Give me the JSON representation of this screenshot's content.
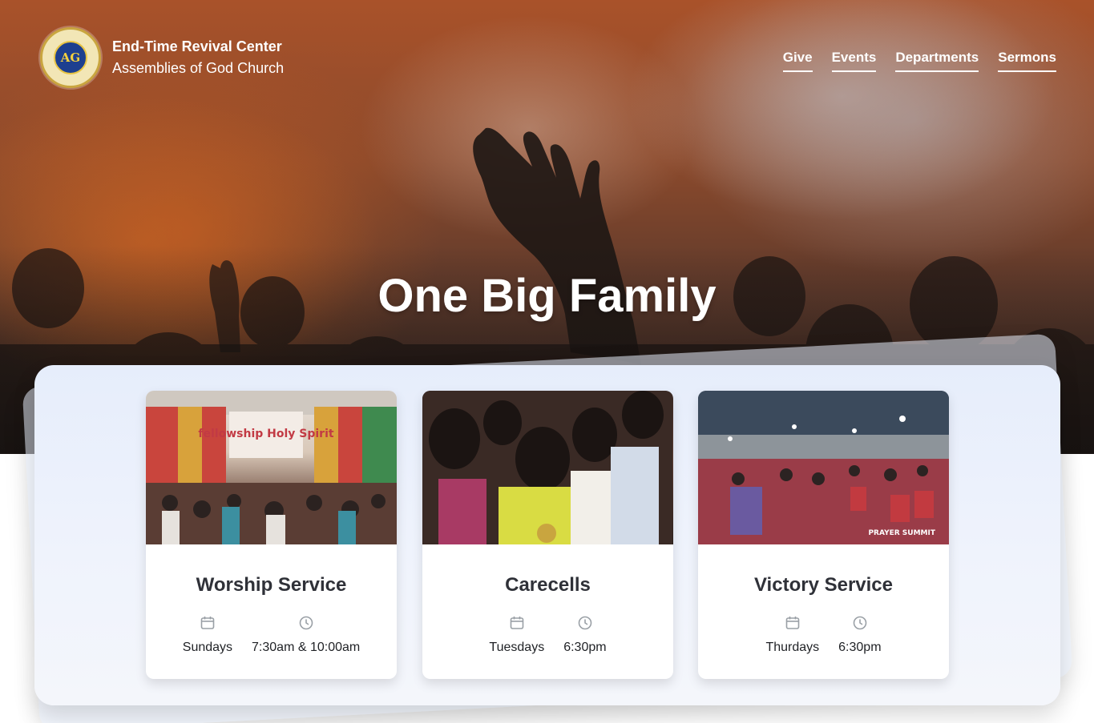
{
  "header": {
    "brand_title": "End-Time Revival Center",
    "brand_subtitle": "Assemblies of God Church",
    "logo_text": "AG",
    "nav": [
      {
        "label": "Give"
      },
      {
        "label": "Events"
      },
      {
        "label": "Departments"
      },
      {
        "label": "Sermons"
      }
    ]
  },
  "hero": {
    "title": "One Big Family"
  },
  "services": [
    {
      "title": "Worship Service",
      "day": "Sundays",
      "time": "7:30am & 10:00am",
      "photo_caption": "fellowship Holy Spirit"
    },
    {
      "title": "Carecells",
      "day": "Tuesdays",
      "time": "6:30pm"
    },
    {
      "title": "Victory Service",
      "day": "Thurdays",
      "time": "6:30pm",
      "photo_caption": "PRAYER SUMMIT"
    }
  ],
  "icons": {
    "day": "calendar-icon",
    "time": "clock-icon"
  },
  "colors": {
    "nav_text": "#ffffff",
    "card_title": "#2f3138",
    "icon_gray": "#9aa0a6",
    "panel_bg": "#e6edfb"
  }
}
